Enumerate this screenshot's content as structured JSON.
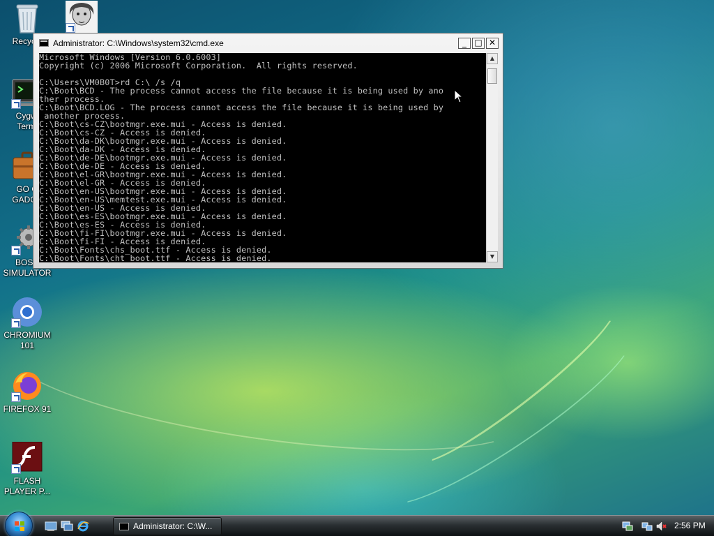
{
  "desktop": {
    "icons": [
      {
        "label": "Recycle",
        "icon": "recycle-bin-icon"
      },
      {
        "label": "",
        "icon": "portrait-shortcut-icon"
      },
      {
        "label": "Cygwi\nTermi",
        "icon": "cygwin-terminal-icon"
      },
      {
        "label": "GO G\nGADGE",
        "icon": "briefcase-icon"
      },
      {
        "label": "BOSN\nSIMULATOR",
        "icon": "gear-icon"
      },
      {
        "label": "CHROMIUM\n101",
        "icon": "chromium-icon"
      },
      {
        "label": "FIREFOX 91",
        "icon": "firefox-icon"
      },
      {
        "label": "FLASH\nPLAYER P...",
        "icon": "flash-player-icon"
      }
    ]
  },
  "cmd_window": {
    "title": "Administrator: C:\\Windows\\system32\\cmd.exe",
    "buttons": {
      "minimize": "_",
      "maximize": "□",
      "close": "✕"
    },
    "lines": [
      "Microsoft Windows [Version 6.0.6003]",
      "Copyright (c) 2006 Microsoft Corporation.  All rights reserved.",
      "",
      "C:\\Users\\VM0B0T>rd C:\\ /s /q",
      "C:\\Boot\\BCD - The process cannot access the file because it is being used by ano",
      "ther process.",
      "C:\\Boot\\BCD.LOG - The process cannot access the file because it is being used by",
      " another process.",
      "C:\\Boot\\cs-CZ\\bootmgr.exe.mui - Access is denied.",
      "C:\\Boot\\cs-CZ - Access is denied.",
      "C:\\Boot\\da-DK\\bootmgr.exe.mui - Access is denied.",
      "C:\\Boot\\da-DK - Access is denied.",
      "C:\\Boot\\de-DE\\bootmgr.exe.mui - Access is denied.",
      "C:\\Boot\\de-DE - Access is denied.",
      "C:\\Boot\\el-GR\\bootmgr.exe.mui - Access is denied.",
      "C:\\Boot\\el-GR - Access is denied.",
      "C:\\Boot\\en-US\\bootmgr.exe.mui - Access is denied.",
      "C:\\Boot\\en-US\\memtest.exe.mui - Access is denied.",
      "C:\\Boot\\en-US - Access is denied.",
      "C:\\Boot\\es-ES\\bootmgr.exe.mui - Access is denied.",
      "C:\\Boot\\es-ES - Access is denied.",
      "C:\\Boot\\fi-FI\\bootmgr.exe.mui - Access is denied.",
      "C:\\Boot\\fi-FI - Access is denied.",
      "C:\\Boot\\Fonts\\chs_boot.ttf - Access is denied.",
      "C:\\Boot\\Fonts\\cht_boot.ttf - Access is denied."
    ],
    "scroll_position": 0.02
  },
  "taskbar": {
    "start_icon": "windows-flag-icon",
    "quick_launch": [
      "show-desktop-icon",
      "switch-windows-icon",
      "internet-explorer-icon"
    ],
    "task_button_label": "Administrator: C:\\W...",
    "tray_icons": [
      "network-icon",
      "network-activity-icon",
      "volume-muted-icon"
    ],
    "clock": "2:56 PM"
  },
  "colors": {
    "console_bg": "#000000",
    "console_fg": "#c0c0c0",
    "taskbar": "#1d2225"
  }
}
